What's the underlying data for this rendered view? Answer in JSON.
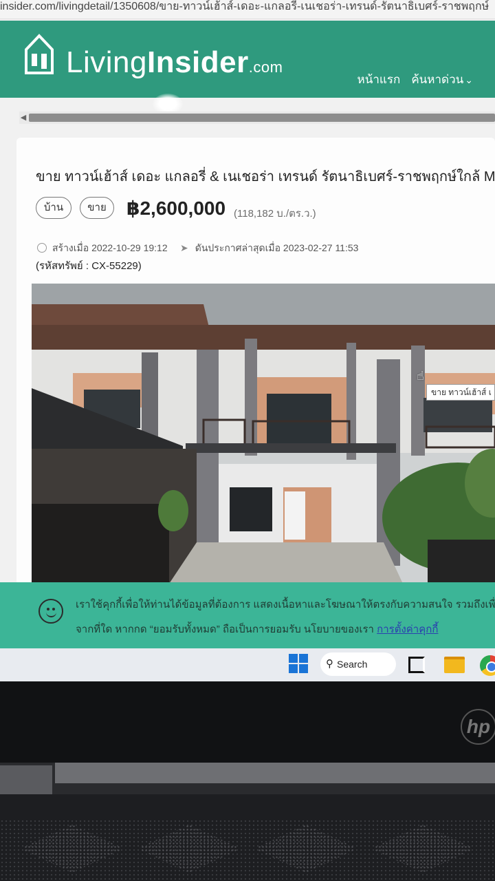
{
  "browser": {
    "url": "insider.com/livingdetail/1350608/ขาย-ทาวน์เฮ้าส์-เดอะ-แกลอรี่-เนเชอร่า-เทรนด์-รัตนาธิเบศร์-ราชพฤกษ์"
  },
  "header": {
    "logo_living": "Living",
    "logo_insider": "Insider",
    "logo_com": ".com",
    "nav_home": "หน้าแรก",
    "nav_quick_search": "ค้นหาด่วน"
  },
  "listing": {
    "title": "ขาย ทาวน์เฮ้าส์ เดอะ แกลอรี่ & เนเชอร่า เทรนด์ รัตนาธิเบศร์-ราชพฤกษ์ใกล้ MRT",
    "tag_type": "บ้าน",
    "tag_deal": "ขาย",
    "price": "฿2,600,000",
    "price_per_area": "(118,182 บ./ตร.ว.)",
    "created": "สร้างเมื่อ 2022-10-29 19:12",
    "updated": "ดันประกาศล่าสุดเมื่อ 2023-02-27 11:53",
    "code": "(รหัสทรัพย์ : CX-55229)",
    "photo_tooltip": "ขาย ทาวน์เฮ้าส์ เ"
  },
  "cookie": {
    "line1": "เราใช้คุกกี้เพื่อให้ท่านได้ข้อมูลที่ต้องการ แสดงเนื้อหาและโฆษณาให้ตรงกับความสนใจ รวมถึงเพื่อ",
    "line2": "จากที่ใด หากกด “ยอมรับทั้งหมด” ถือเป็นการยอมรับ นโยบายของเรา ",
    "link": "การตั้งค่าคุกกี้"
  },
  "taskbar": {
    "search_label": "Search"
  },
  "laptop": {
    "brand": "hp"
  },
  "colors": {
    "brand_green": "#2f9a7e",
    "cookie_green": "#3cb597"
  }
}
